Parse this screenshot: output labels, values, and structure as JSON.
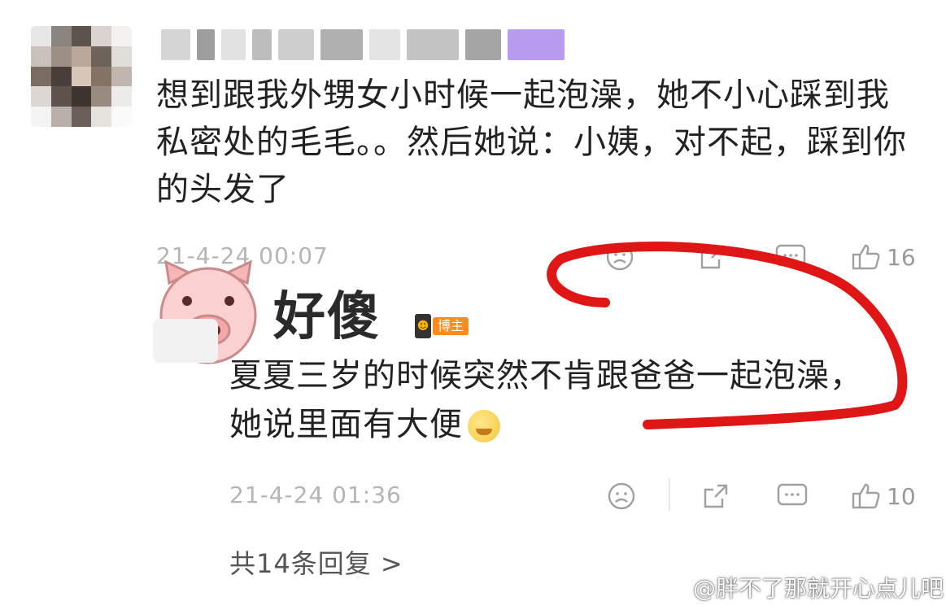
{
  "comment": {
    "text": "想到跟我外甥女小时候一起泡澡，她不小心踩到我私密处的毛毛。。然后她说：小姨，对不起，踩到你的头发了",
    "time": "21-4-24 00:07",
    "like_count": "16"
  },
  "sticker": {
    "caption": "好傻"
  },
  "reply": {
    "badge_label": "博主",
    "text": "夏夏三岁的时候突然不肯跟爸爸一起泡澡，她说里面有大便",
    "time": "21-4-24 01:36",
    "like_count": "10"
  },
  "footer": {
    "reply_count_label": "共14条回复 >"
  },
  "watermark": {
    "text": "@胖不了那就开心点儿吧"
  },
  "icons": {
    "dislike": "sad-face-icon",
    "share": "share-icon",
    "comment": "comment-icon",
    "like": "thumbs-up-icon"
  },
  "colors": {
    "annotation_red": "#e01515",
    "meta_gray": "#b5b5b5",
    "blogger_badge": "#ff8a1e"
  }
}
